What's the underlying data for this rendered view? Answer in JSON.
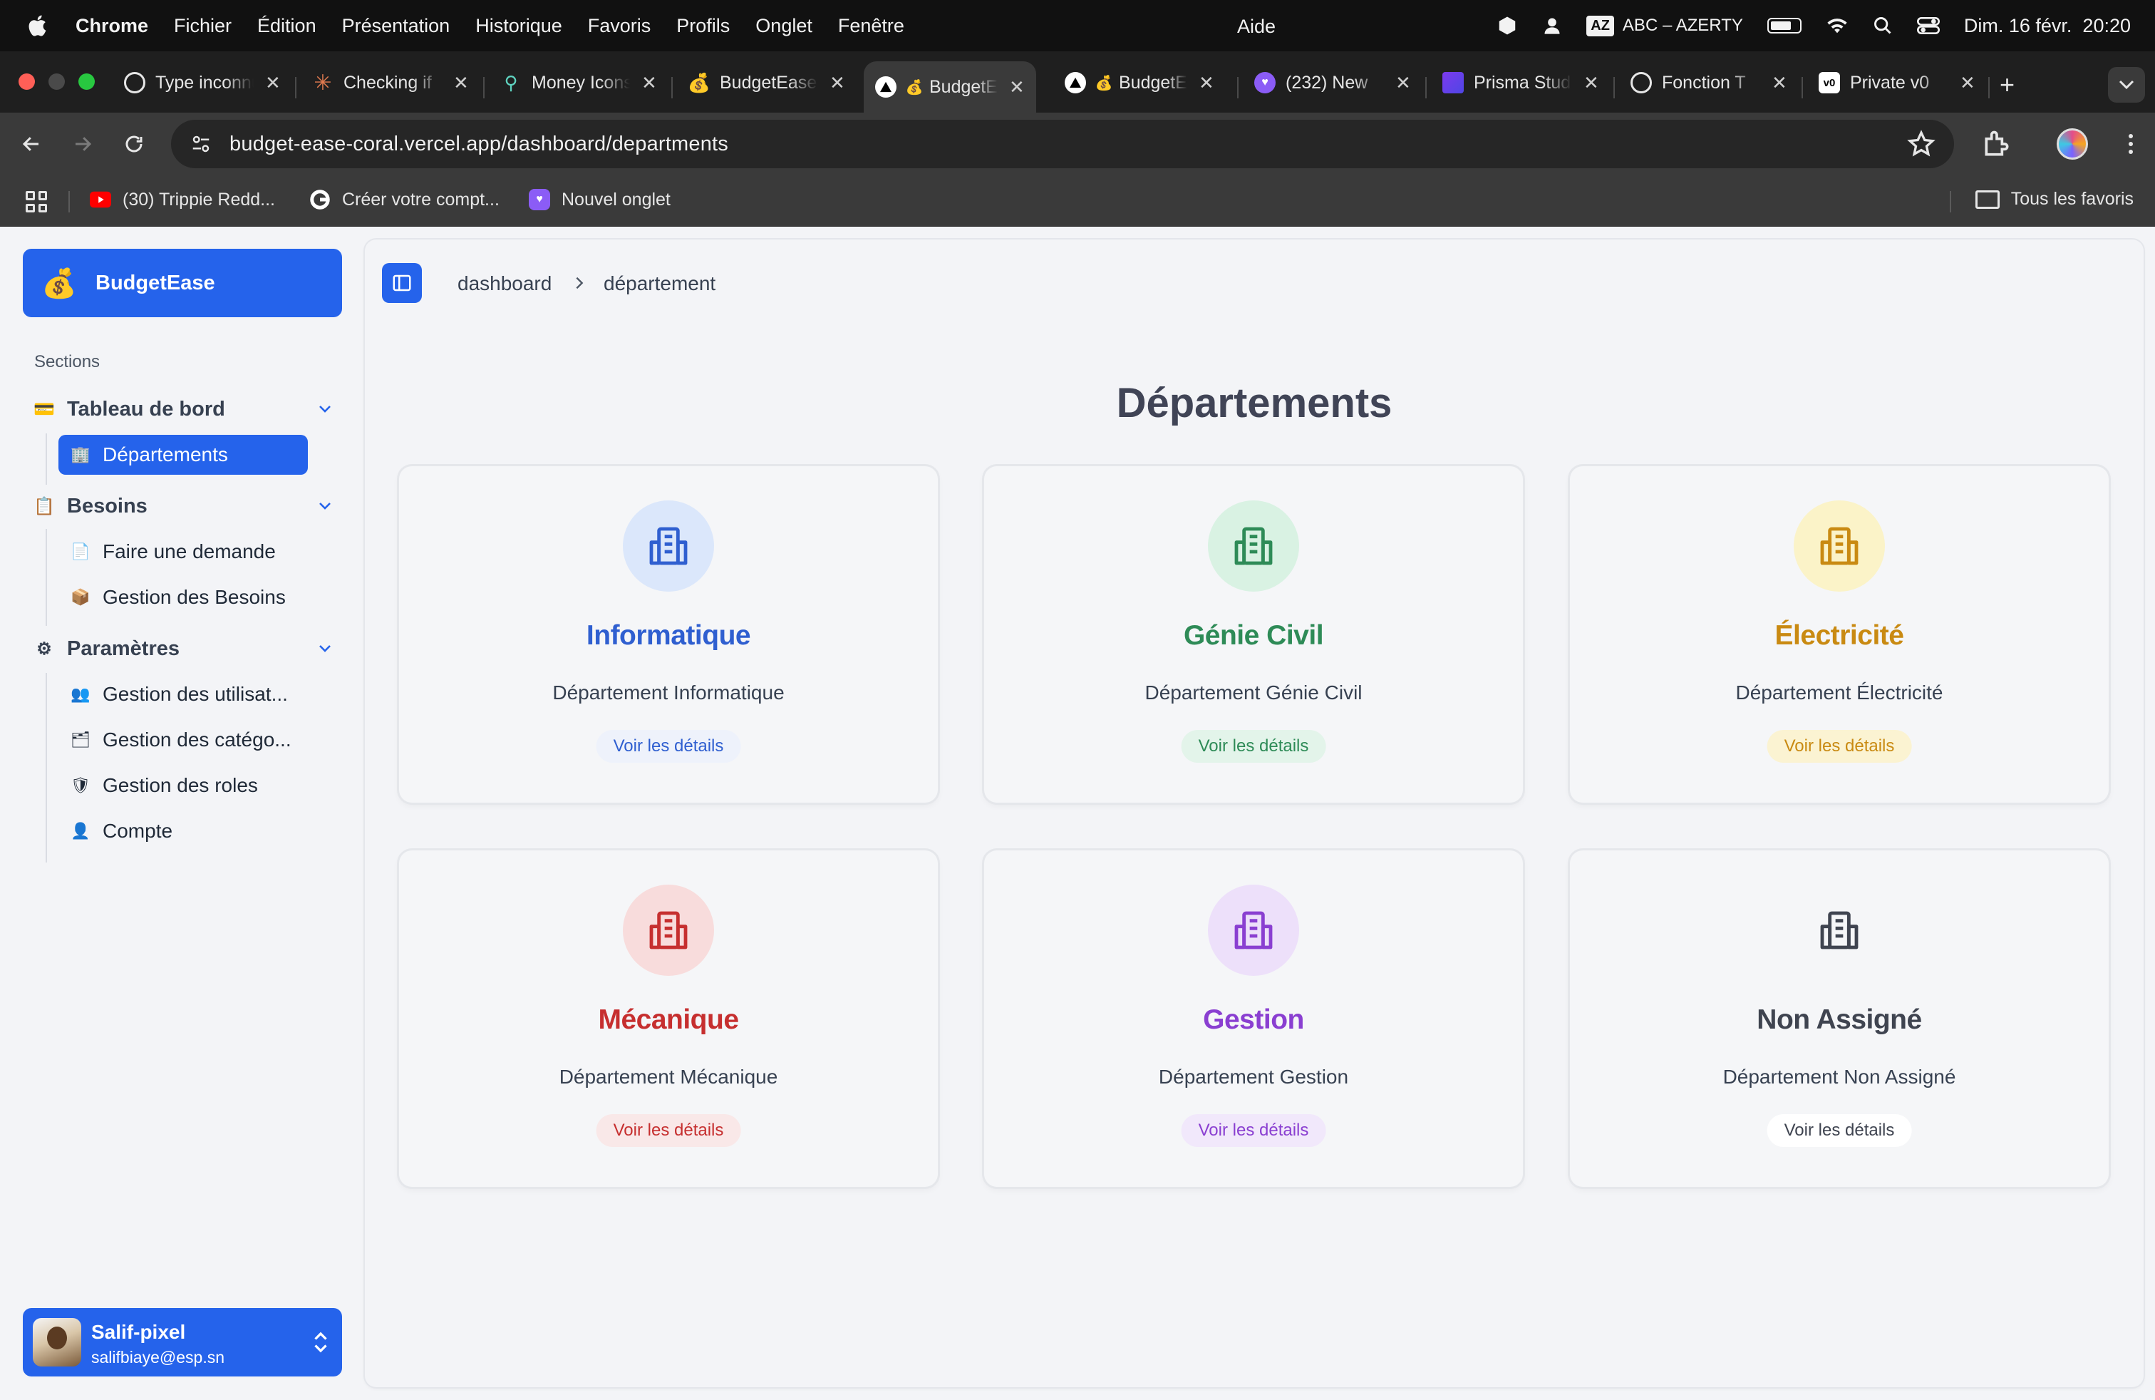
{
  "menubar": {
    "items": [
      "Chrome",
      "Fichier",
      "Édition",
      "Présentation",
      "Historique",
      "Favoris",
      "Profils",
      "Onglet",
      "Fenêtre"
    ],
    "help": "Aide",
    "keyboard_badge": "AZ",
    "keyboard_layout": "ABC – AZERTY",
    "datetime": "Dim. 16 févr.  20:20"
  },
  "tabs": [
    {
      "label": "Type inconnu",
      "icon": "openai-icon"
    },
    {
      "label": "Checking if",
      "icon": "claude-icon"
    },
    {
      "label": "Money Icons",
      "icon": "pin-icon"
    },
    {
      "label": "BudgetEase",
      "icon": "money-bag-icon"
    },
    {
      "label": "BudgetEase",
      "icon": "vercel-icon",
      "active": true
    },
    {
      "label": "BudgetEase",
      "icon": "vercel-icon"
    },
    {
      "label": "(232) New",
      "icon": "purple-icon"
    },
    {
      "label": "Prisma Studio",
      "icon": "prisma-icon"
    },
    {
      "label": "Fonction T",
      "icon": "openai-icon"
    },
    {
      "label": "Private v0",
      "icon": "v0-icon"
    }
  ],
  "omnibox": {
    "url": "budget-ease-coral.vercel.app/dashboard/departments"
  },
  "bookmarks": {
    "items": [
      {
        "label": "(30) Trippie Redd...",
        "icon": "youtube-icon"
      },
      {
        "label": "Créer votre compt...",
        "icon": "google-icon"
      },
      {
        "label": "Nouvel onglet",
        "icon": "purple-icon"
      }
    ],
    "all_label": "Tous les favoris"
  },
  "sidebar": {
    "brand": "BudgetEase",
    "sections_label": "Sections",
    "groups": [
      {
        "label": "Tableau de bord",
        "icon": "💳",
        "items": [
          {
            "label": "Départements",
            "icon": "🏢",
            "active": true
          }
        ]
      },
      {
        "label": "Besoins",
        "icon": "📋",
        "items": [
          {
            "label": "Faire une demande",
            "icon": "📄"
          },
          {
            "label": "Gestion des Besoins",
            "icon": "📦"
          }
        ]
      },
      {
        "label": "Paramètres",
        "icon": "⚙",
        "items": [
          {
            "label": "Gestion des utilisat...",
            "icon": "👥"
          },
          {
            "label": "Gestion des catégo...",
            "icon": "🗂"
          },
          {
            "label": "Gestion des roles",
            "icon": "🛡"
          },
          {
            "label": "Compte",
            "icon": "👤"
          }
        ]
      }
    ],
    "user": {
      "name": "Salif-pixel",
      "email": "salifbiaye@esp.sn"
    }
  },
  "breadcrumb": {
    "root": "dashboard",
    "current": "département"
  },
  "page_title": "Départements",
  "cards": [
    {
      "title": "Informatique",
      "description": "Département Informatique",
      "link": "Voir les détails",
      "color": "#2f5fd0",
      "bg": "#dbe7fb",
      "pill": "#eef2fb"
    },
    {
      "title": "Génie Civil",
      "description": "Département Génie Civil",
      "link": "Voir les détails",
      "color": "#2e8b57",
      "bg": "#d9f2e3",
      "pill": "#e3f4ea"
    },
    {
      "title": "Électricité",
      "description": "Département Électricité",
      "link": "Voir les détails",
      "color": "#c98a12",
      "bg": "#fbf3c8",
      "pill": "#fbf3d2"
    },
    {
      "title": "Mécanique",
      "description": "Département Mécanique",
      "link": "Voir les détails",
      "color": "#c62f2f",
      "bg": "#f8dcdc",
      "pill": "#f9e8e8"
    },
    {
      "title": "Gestion",
      "description": "Département Gestion",
      "link": "Voir les détails",
      "color": "#8a3fd1",
      "bg": "#ede0fa",
      "pill": "#f1e8fb"
    },
    {
      "title": "Non Assigné",
      "description": "Département Non Assigné",
      "link": "Voir les détails",
      "color": "#3f4450",
      "bg": "transparent",
      "pill": "#ffffff"
    }
  ]
}
